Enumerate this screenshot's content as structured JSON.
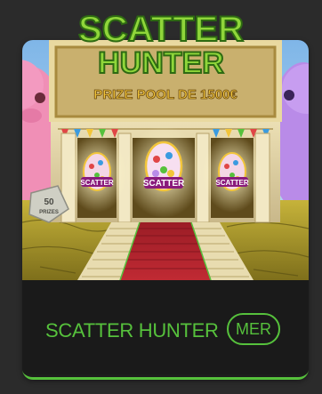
{
  "promo": {
    "headline_line1": "SCATTER",
    "headline_line2": "HUNTER",
    "prize_pool": "PRIZE POOL DE 1500€",
    "prizes_badge_count": "50",
    "prizes_badge_label": "PRIZES",
    "egg_label": "SCATTER"
  },
  "card": {
    "title": "SCATTER HUNTER",
    "more_label": "MER"
  },
  "colors": {
    "page_bg": "#2b2b2b",
    "card_footer_bg": "#1a1a1a",
    "accent_green": "#56c13c",
    "headline_green": "#8fd63a",
    "prize_gold": "#f2c53a",
    "carpet_red": "#b8262f"
  }
}
